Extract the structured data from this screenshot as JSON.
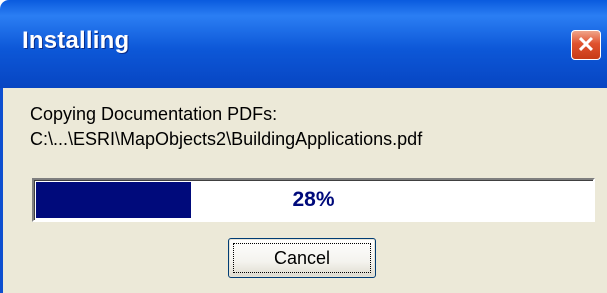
{
  "window": {
    "title": "Installing",
    "close_label": "✕"
  },
  "status": {
    "line1": "Copying Documentation PDFs:",
    "line2": "C:\\...\\ESRI\\MapObjects2\\BuildingApplications.pdf"
  },
  "progress": {
    "percent": 28,
    "label": "28%",
    "fill_color": "#000a7b"
  },
  "buttons": {
    "cancel_label": "Cancel"
  },
  "colors": {
    "titlebar": "#0d58d8",
    "client": "#ece9d8",
    "close": "#e0522e"
  }
}
